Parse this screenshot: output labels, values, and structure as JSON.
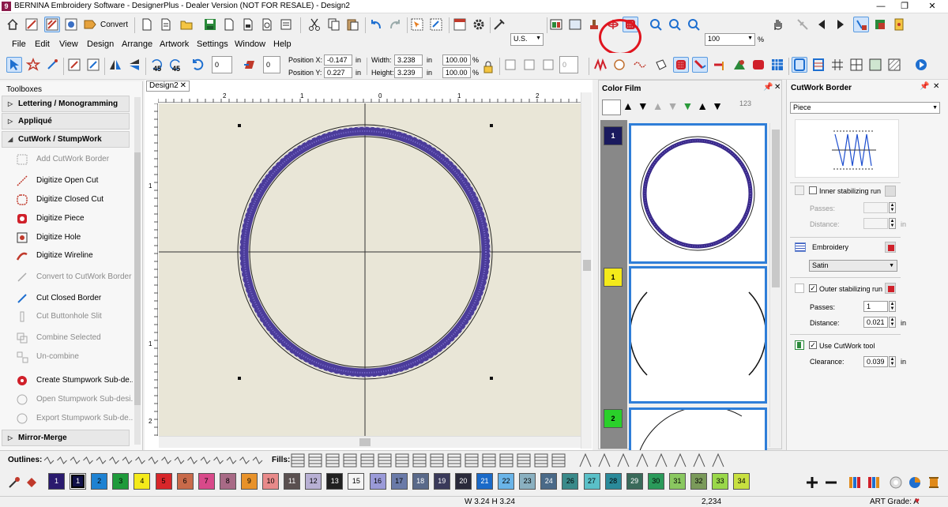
{
  "window": {
    "title": "BERNINA Embroidery Software - DesignerPlus - Dealer Version (NOT FOR RESALE) - Design2",
    "app_icon_letter": "9",
    "minimize": "—",
    "restore": "❐",
    "close": "✕"
  },
  "toolbar1": {
    "convert_label": "Convert",
    "units": "U.S.",
    "zoom": "100",
    "zoom_unit": "%"
  },
  "menu": [
    "File",
    "Edit",
    "View",
    "Design",
    "Arrange",
    "Artwork",
    "Settings",
    "Window",
    "Help"
  ],
  "toolbar2": {
    "rotate45_left": "45",
    "rotate45_right": "45",
    "rotate_value": "0",
    "skew_value": "0",
    "pos_x_label": "Position X:",
    "pos_x_value": "-0.147",
    "pos_x_unit": "in",
    "pos_y_label": "Position Y:",
    "pos_y_value": "0.227",
    "pos_y_unit": "in",
    "width_label": "Width:",
    "width_value": "3.238",
    "width_unit": "in",
    "width_pct": "100.00",
    "height_label": "Height:",
    "height_value": "3.239",
    "height_unit": "in",
    "height_pct": "100.00",
    "pct": "%"
  },
  "toolbox": {
    "title": "Toolboxes",
    "groups": [
      {
        "label": "Lettering / Monogramming",
        "arrow": "▷"
      },
      {
        "label": "Appliqué",
        "arrow": "▷"
      },
      {
        "label": "CutWork / StumpWork",
        "arrow": "◢"
      },
      {
        "label": "Mirror-Merge",
        "arrow": "▷"
      }
    ],
    "items": [
      {
        "label": "Add CutWork Border",
        "enabled": false
      },
      {
        "label": "Digitize Open Cut",
        "enabled": true
      },
      {
        "label": "Digitize Closed Cut",
        "enabled": true
      },
      {
        "label": "Digitize Piece",
        "enabled": true
      },
      {
        "label": "Digitize Hole",
        "enabled": true
      },
      {
        "label": "Digitize Wireline",
        "enabled": true
      },
      {
        "label": "Convert to CutWork Border",
        "enabled": false
      },
      {
        "label": "Cut Closed Border",
        "enabled": true
      },
      {
        "label": "Cut Buttonhole Slit",
        "enabled": false
      },
      {
        "label": "Combine Selected",
        "enabled": false
      },
      {
        "label": "Un-combine",
        "enabled": false
      },
      {
        "label": "Create Stumpwork Sub-de...",
        "enabled": true
      },
      {
        "label": "Open Stumpwork Sub-desi...",
        "enabled": false
      },
      {
        "label": "Export Stumpwork Sub-de...",
        "enabled": false
      }
    ]
  },
  "document": {
    "tab_label": "Design2",
    "tab_close": "✕",
    "ruler_top_ticks": [
      "2",
      "1",
      "0",
      "1",
      "2"
    ],
    "ruler_left_ticks": [
      "1",
      "1",
      "2"
    ]
  },
  "color_film": {
    "title": "Color Film",
    "frames": [
      {
        "number": "1"
      },
      {
        "number": "1"
      },
      {
        "number": "2"
      }
    ],
    "sort_label": "123"
  },
  "cutwork_border": {
    "title": "CutWork Border",
    "type_value": "Piece",
    "inner_label": "Inner stabilizing run",
    "inner_checked": false,
    "inner_passes_label": "Passes:",
    "inner_distance_label": "Distance:",
    "inner_unit": "in",
    "embroidery_label": "Embroidery",
    "embroidery_value": "Satin",
    "outer_label": "Outer stabilizing run",
    "outer_checked": true,
    "outer_passes_label": "Passes:",
    "outer_passes_value": "1",
    "outer_distance_label": "Distance:",
    "outer_distance_value": "0.021",
    "outer_unit": "in",
    "cutwork_tool_label": "Use CutWork tool",
    "cutwork_tool_checked": true,
    "clearance_label": "Clearance:",
    "clearance_value": "0.039",
    "clearance_unit": "in"
  },
  "stitchbar": {
    "outlines_label": "Outlines:",
    "fills_label": "Fills:"
  },
  "palette": {
    "swatches": [
      {
        "n": "1",
        "color": "#2a1a6e",
        "selected": false
      },
      {
        "n": "1",
        "color": "#101048",
        "selected": true
      },
      {
        "n": "2",
        "color": "#1e82d2",
        "selected": false
      },
      {
        "n": "3",
        "color": "#1e9a3a",
        "selected": false
      },
      {
        "n": "4",
        "color": "#f4ea1a",
        "selected": false
      },
      {
        "n": "5",
        "color": "#d8262a",
        "selected": false
      },
      {
        "n": "6",
        "color": "#c86a4a",
        "selected": false
      },
      {
        "n": "7",
        "color": "#d84a8a",
        "selected": false
      },
      {
        "n": "8",
        "color": "#a86a86",
        "selected": false
      },
      {
        "n": "9",
        "color": "#e8922a",
        "selected": false
      },
      {
        "n": "10",
        "color": "#e88a8a",
        "selected": false
      },
      {
        "n": "11",
        "color": "#5a5050",
        "selected": false
      },
      {
        "n": "12",
        "color": "#b8b0d4",
        "selected": false
      },
      {
        "n": "13",
        "color": "#202020",
        "selected": false
      },
      {
        "n": "15",
        "color": "#f4f4f4",
        "selected": false
      },
      {
        "n": "16",
        "color": "#9a9ad8",
        "selected": false
      },
      {
        "n": "17",
        "color": "#6a7aa8",
        "selected": false
      },
      {
        "n": "18",
        "color": "#5a6a8a",
        "selected": false
      },
      {
        "n": "19",
        "color": "#3a3a5a",
        "selected": false
      },
      {
        "n": "20",
        "color": "#2a2a3a",
        "selected": false
      },
      {
        "n": "21",
        "color": "#1a6ac8",
        "selected": false
      },
      {
        "n": "22",
        "color": "#6ab4e8",
        "selected": false
      },
      {
        "n": "23",
        "color": "#8ab0c0",
        "selected": false
      },
      {
        "n": "24",
        "color": "#4a6a88",
        "selected": false
      },
      {
        "n": "26",
        "color": "#3a8a8a",
        "selected": false
      },
      {
        "n": "27",
        "color": "#5ac0c8",
        "selected": false
      },
      {
        "n": "28",
        "color": "#2a8a9a",
        "selected": false
      },
      {
        "n": "29",
        "color": "#3a6a5a",
        "selected": false
      },
      {
        "n": "30",
        "color": "#2a9a5a",
        "selected": false
      },
      {
        "n": "31",
        "color": "#8ac860",
        "selected": false
      },
      {
        "n": "32",
        "color": "#7a9a5a",
        "selected": false
      },
      {
        "n": "33",
        "color": "#9ad84a",
        "selected": false
      },
      {
        "n": "34",
        "color": "#c8e040",
        "selected": false
      }
    ]
  },
  "status": {
    "size": "W 3.24 H 3.24",
    "stitches": "2,234",
    "art_grade": "ART Grade: A"
  }
}
